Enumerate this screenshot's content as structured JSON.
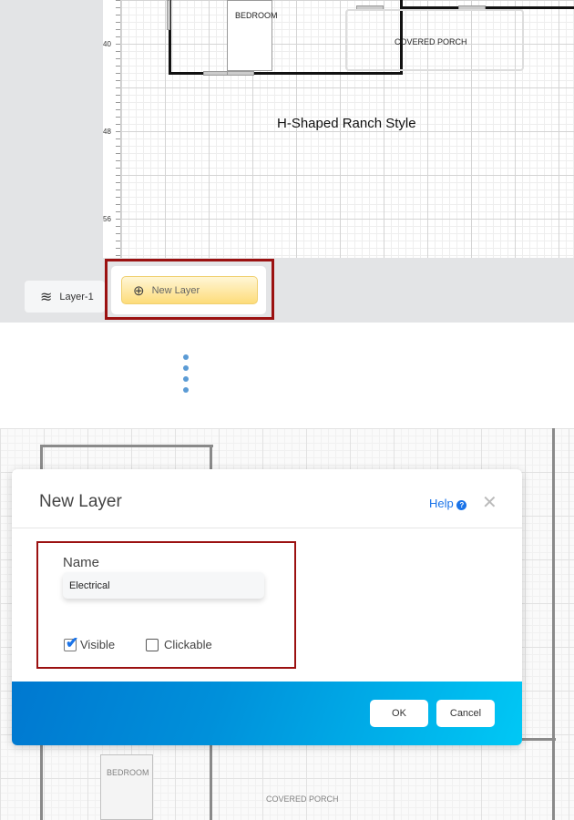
{
  "top": {
    "ruler_ticks": [
      "40",
      "48",
      "56"
    ],
    "plan_labels": {
      "bedroom": "BEDROOM",
      "porch": "COVERED PORCH"
    },
    "plan_title": "H-Shaped Ranch Style",
    "layers": [
      {
        "label": "Layer-1",
        "icon": "layers-icon"
      }
    ],
    "new_layer_button": {
      "label": "New Layer",
      "icon": "add-layer-icon"
    }
  },
  "dialog": {
    "title": "New Layer",
    "help_label": "Help",
    "name_label": "Name",
    "name_value": "Electrical",
    "visible_label": "Visible",
    "visible_checked": true,
    "clickable_label": "Clickable",
    "clickable_checked": false,
    "ok_label": "OK",
    "cancel_label": "Cancel"
  },
  "bottom": {
    "plan_labels": {
      "bedroom": "BEDROOM",
      "porch": "COVERED PORCH"
    }
  },
  "colors": {
    "highlight": "#9b1111",
    "accent": "#1a73e8",
    "footer_start": "#0078d0",
    "footer_end": "#00c8f5",
    "button_yellow": "#fde49a"
  }
}
